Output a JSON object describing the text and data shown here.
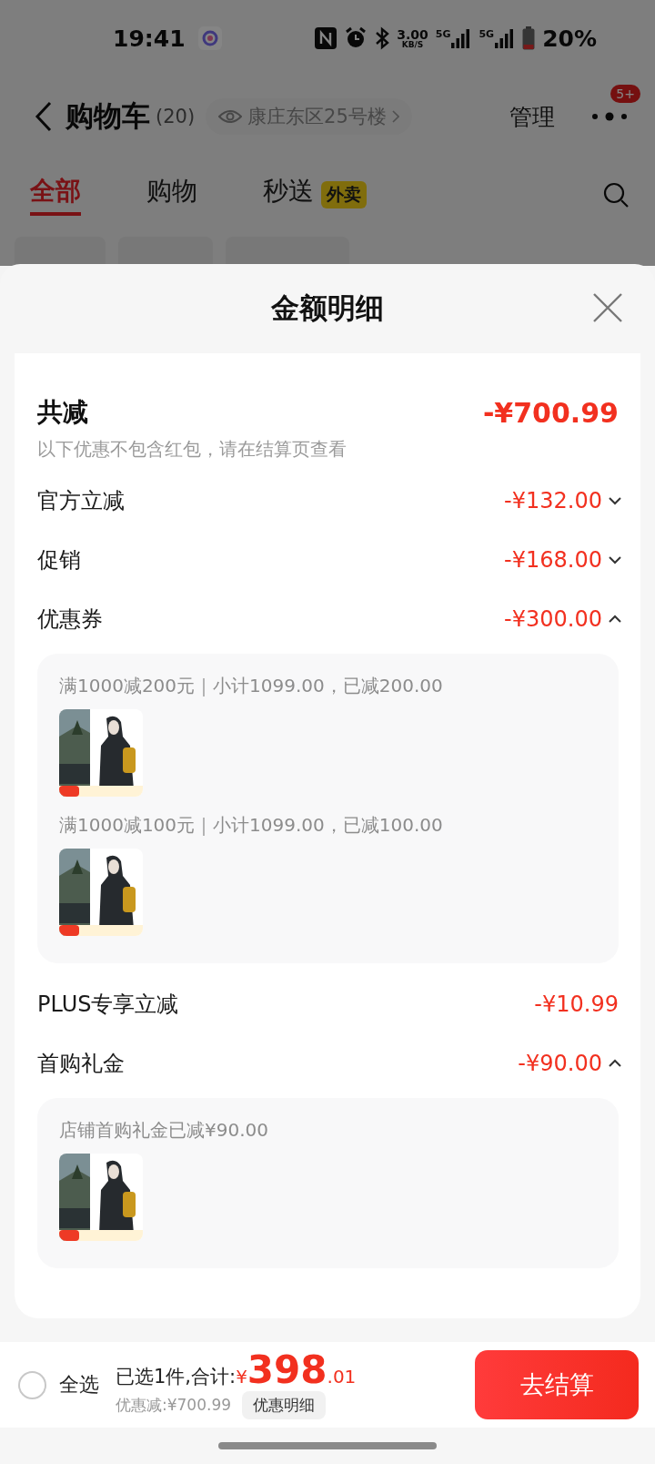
{
  "status_bar": {
    "time": "19:41",
    "speed": "3.00",
    "speed_unit": "KB/S",
    "network_1": "5G",
    "network_2": "5G",
    "battery": "20%"
  },
  "header": {
    "title": "购物车",
    "count": "(20)",
    "address": "康庄东区25号楼",
    "manage": "管理",
    "badge": "5+"
  },
  "tabs": [
    {
      "label": "全部",
      "selected": true
    },
    {
      "label": "购物",
      "selected": false
    },
    {
      "label": "秒送",
      "tag": "外卖",
      "selected": false
    }
  ],
  "sheet": {
    "title": "金额明细",
    "total": {
      "label": "共减",
      "amount": "-¥700.99",
      "note": "以下优惠不包含红包，请在结算页查看"
    },
    "rows": [
      {
        "label": "官方立减",
        "amount": "-¥132.00",
        "kind": "collapsed"
      },
      {
        "label": "促销",
        "amount": "-¥168.00",
        "kind": "collapsed"
      },
      {
        "label": "优惠券",
        "amount": "-¥300.00",
        "kind": "expanded",
        "details": [
          {
            "text": "满1000减200元｜小计1099.00，已减200.00"
          },
          {
            "text": "满1000减100元｜小计1099.00，已减100.00"
          }
        ]
      },
      {
        "label": "PLUS专享立减",
        "amount": "-¥10.99",
        "kind": "plain"
      },
      {
        "label": "首购礼金",
        "amount": "-¥90.00",
        "kind": "expanded",
        "details": [
          {
            "text": "店铺首购礼金已减¥90.00"
          }
        ]
      }
    ]
  },
  "bottom_bar": {
    "select_all": {
      "label": "全选",
      "checked": false
    },
    "summary": "已选1件,合计:",
    "currency": "¥",
    "price_integer": "398",
    "price_decimal": ".01",
    "discount": "优惠减:¥700.99",
    "detail_button": "优惠明细",
    "checkout": "去结算"
  }
}
